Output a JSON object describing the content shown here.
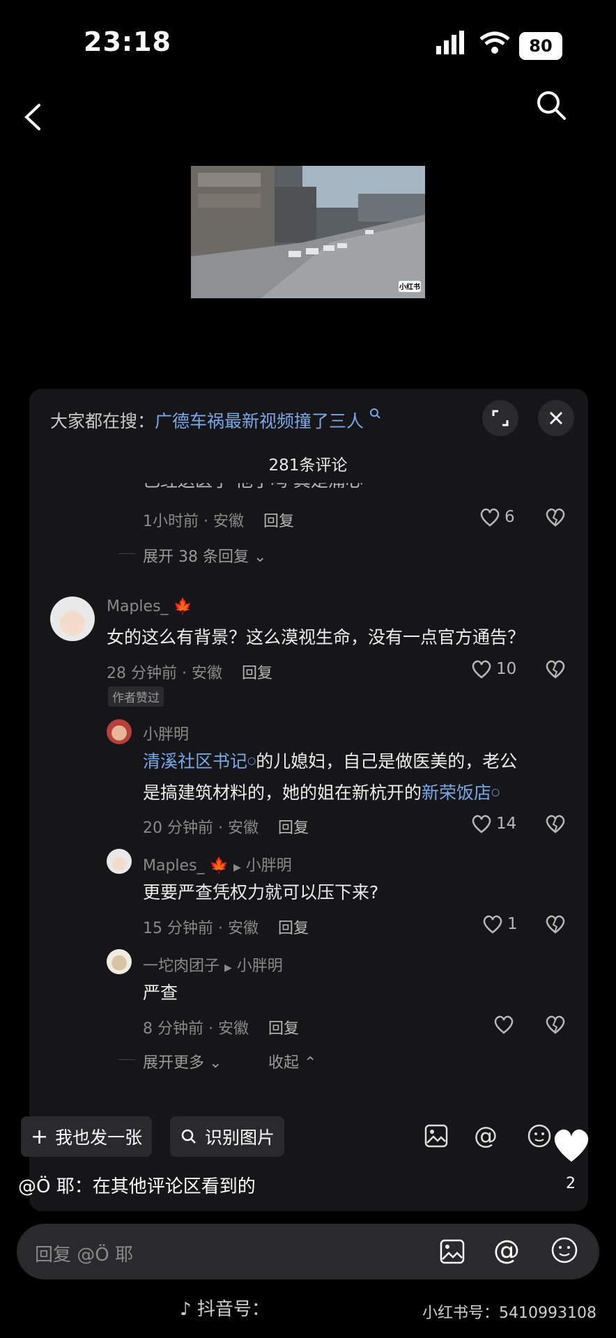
{
  "status": {
    "time": "23:18",
    "battery": "80"
  },
  "search": {
    "prefix": "大家都在搜：",
    "query": "广德车祸最新视频撞了三人"
  },
  "comments_count": "281条评论",
  "top_comment": {
    "partial_text": "已经送医了 他了吗 真是痛心",
    "time": "1小时前 · 安徽",
    "reply": "回复",
    "likes": "6",
    "expand": "展开 38 条回复"
  },
  "comment": {
    "user": "Maples_",
    "text": "女的这么有背景？这么漠视生命，没有一点官方通告？",
    "time": "28 分钟前 · 安徽",
    "reply": "回复",
    "likes": "10",
    "author_badge": "作者赞过"
  },
  "replies": [
    {
      "user": "小胖明",
      "text_link1": "清溪社区书记",
      "text_mid": "的儿媳妇，自己是做医美的，老公",
      "text_line2": "是搞建筑材料的，她的姐在新杭开的",
      "text_link2": "新荣饭店",
      "time": "20 分钟前 · 安徽",
      "reply": "回复",
      "likes": "14"
    },
    {
      "user": "Maples_",
      "to": "小胖明",
      "text": "更要严查凭权力就可以压下来?",
      "time": "15 分钟前 · 安徽",
      "reply": "回复",
      "likes": "1"
    },
    {
      "user": "一坨肉团子",
      "to": "小胖明",
      "text": "严查",
      "time": "8 分钟前 · 安徽",
      "reply": "回复",
      "likes": ""
    }
  ],
  "expand_more": "展开更多",
  "collapse": "收起",
  "chips": {
    "post": "我也发一张",
    "identify": "识别图片"
  },
  "caption": "@Ö 耶：在其他评论区看到的",
  "like_count": "2",
  "reply_placeholder": "回复 @Ö 耶",
  "watermark": {
    "douyin": "抖音号：",
    "xhs": "小红书号：5410993108"
  },
  "video_logo": "小红书"
}
